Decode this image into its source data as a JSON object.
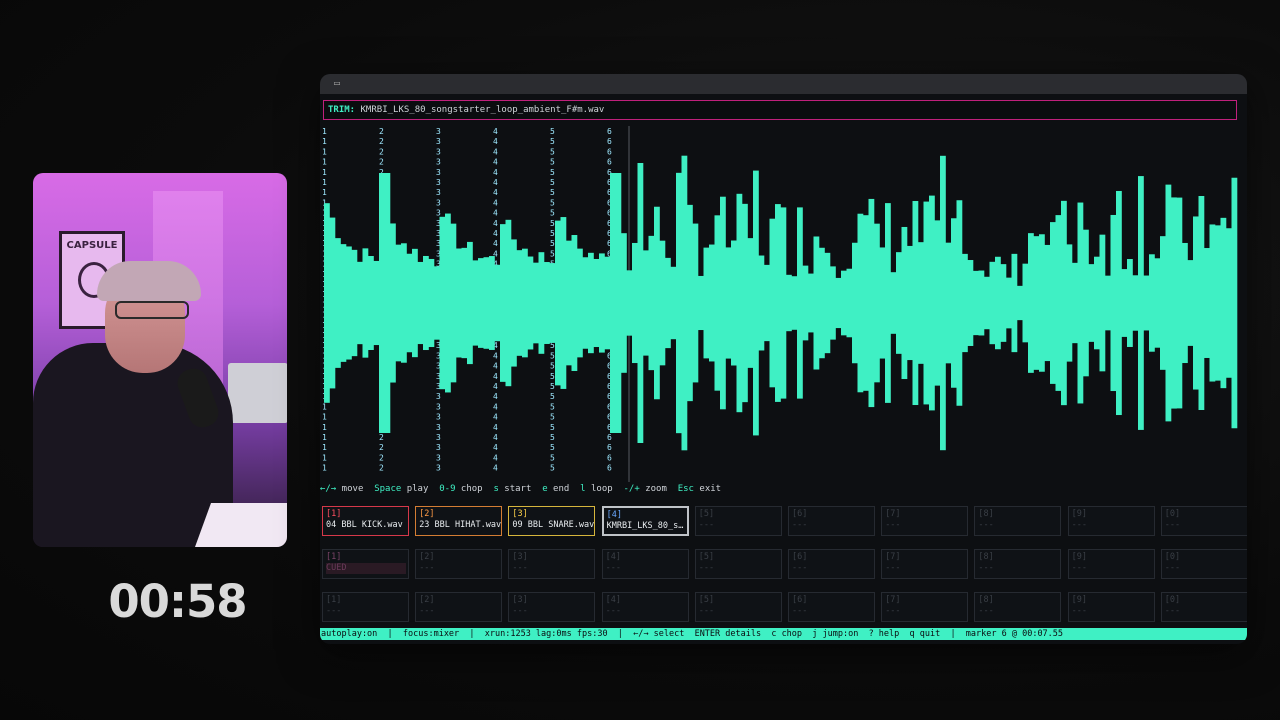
{
  "timer": "00:58",
  "webcam": {
    "poster_text": "CAPSULE"
  },
  "window": {
    "tab_icon": "terminal-icon"
  },
  "trim": {
    "label": "TRIM:",
    "filename": "KMRBI_LKS_80_songstarter_loop_ambient_F#m.wav"
  },
  "waveform": {
    "marker_labels": [
      "1",
      "2",
      "3",
      "4",
      "5",
      "6"
    ],
    "color": "#3ff0c4",
    "playhead_color": "#555a60"
  },
  "keyhelp": [
    {
      "key": "←/→",
      "action": "move"
    },
    {
      "key": "Space",
      "action": "play"
    },
    {
      "key": "0-9",
      "action": "chop"
    },
    {
      "key": "s",
      "action": "start"
    },
    {
      "key": "e",
      "action": "end"
    },
    {
      "key": "l",
      "action": "loop"
    },
    {
      "key": "-/+",
      "action": "zoom"
    },
    {
      "key": "Esc",
      "action": "exit"
    }
  ],
  "pads": {
    "row1": [
      {
        "num": "[1]",
        "label": "04 BBL KICK.wav"
      },
      {
        "num": "[2]",
        "label": "23 BBL HIHAT.wav"
      },
      {
        "num": "[3]",
        "label": "09 BBL SNARE.wav"
      },
      {
        "num": "[4]",
        "label": "KMRBI_LKS_80_s…"
      },
      {
        "num": "[5]",
        "label": "---"
      },
      {
        "num": "[6]",
        "label": "---"
      },
      {
        "num": "[7]",
        "label": "---"
      },
      {
        "num": "[8]",
        "label": "---"
      },
      {
        "num": "[9]",
        "label": "---"
      },
      {
        "num": "[0]",
        "label": "---"
      }
    ],
    "row2": [
      {
        "num": "[1]",
        "label": "CUED"
      },
      {
        "num": "[2]",
        "label": "---"
      },
      {
        "num": "[3]",
        "label": "---"
      },
      {
        "num": "[4]",
        "label": "---"
      },
      {
        "num": "[5]",
        "label": "---"
      },
      {
        "num": "[6]",
        "label": "---"
      },
      {
        "num": "[7]",
        "label": "---"
      },
      {
        "num": "[8]",
        "label": "---"
      },
      {
        "num": "[9]",
        "label": "---"
      },
      {
        "num": "[0]",
        "label": "---"
      }
    ],
    "row3": [
      {
        "num": "[1]",
        "label": "---"
      },
      {
        "num": "[2]",
        "label": "---"
      },
      {
        "num": "[3]",
        "label": "---"
      },
      {
        "num": "[4]",
        "label": "---"
      },
      {
        "num": "[5]",
        "label": "---"
      },
      {
        "num": "[6]",
        "label": "---"
      },
      {
        "num": "[7]",
        "label": "---"
      },
      {
        "num": "[8]",
        "label": "---"
      },
      {
        "num": "[9]",
        "label": "---"
      },
      {
        "num": "[0]",
        "label": "---"
      }
    ]
  },
  "status": "autoplay:on  |  focus:mixer  |  xrun:1253 lag:0ms fps:30  |  ←/→ select  ENTER details  c chop  j jump:on  ? help  q quit  |  marker 6 @ 00:07.55"
}
